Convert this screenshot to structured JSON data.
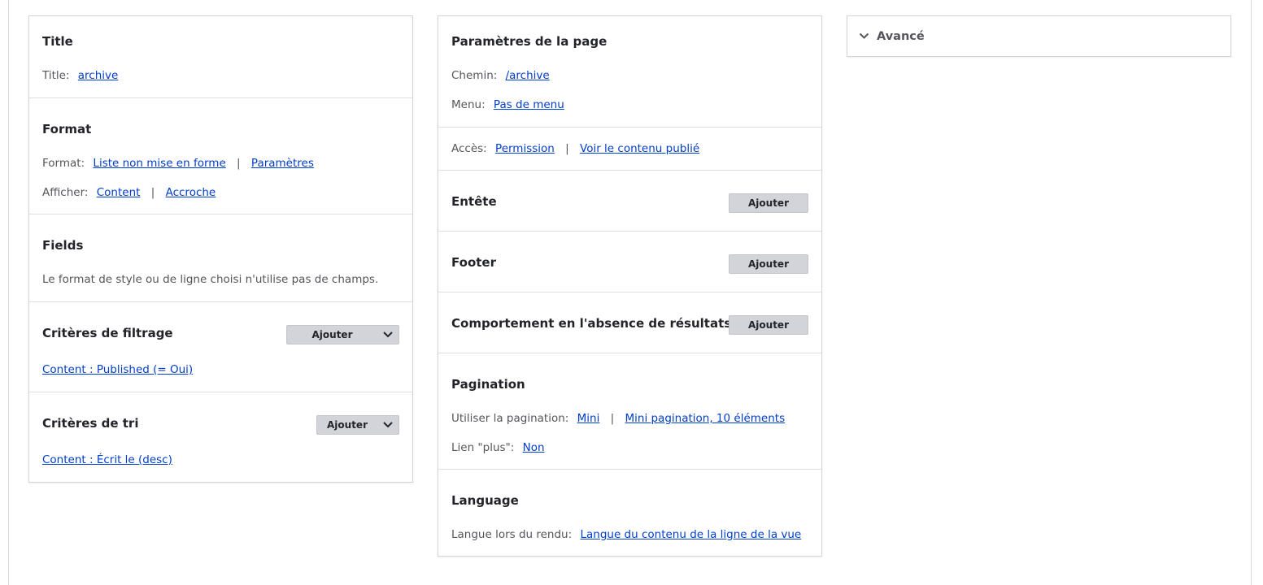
{
  "col1": {
    "title_section": {
      "heading": "Title",
      "label": "Title:",
      "value": "archive"
    },
    "format_section": {
      "heading": "Format",
      "format_label": "Format:",
      "format_value": "Liste non mise en forme",
      "format_settings": "Paramètres",
      "show_label": "Afficher:",
      "show_value": "Content",
      "show_settings": "Accroche"
    },
    "fields_section": {
      "heading": "Fields",
      "note": "Le format de style ou de ligne choisi n'utilise pas de champs."
    },
    "filter_section": {
      "heading": "Critères de filtrage",
      "add_label": "Ajouter",
      "item": "Content : Published (= Oui)"
    },
    "sort_section": {
      "heading": "Critères de tri",
      "add_label": "Ajouter",
      "item": "Content : Écrit le (desc)"
    }
  },
  "col2": {
    "page_section": {
      "heading": "Paramètres de la page",
      "path_label": "Chemin:",
      "path_value": "/archive",
      "menu_label": "Menu:",
      "menu_value": "Pas de menu"
    },
    "access_section": {
      "label": "Accès:",
      "value": "Permission",
      "extra": "Voir le contenu publié"
    },
    "header_section": {
      "heading": "Entête",
      "add_label": "Ajouter"
    },
    "footer_section": {
      "heading": "Footer",
      "add_label": "Ajouter"
    },
    "empty_section": {
      "heading": "Comportement en l'absence de résultats",
      "add_label": "Ajouter"
    },
    "pager_section": {
      "heading": "Pagination",
      "use_label": "Utiliser la pagination:",
      "use_value": "Mini",
      "use_detail": "Mini pagination, 10 éléments",
      "more_label": "Lien \"plus\":",
      "more_value": "Non"
    },
    "language_section": {
      "heading": "Language",
      "label": "Langue lors du rendu:",
      "value": "Langue du contenu de la ligne de la vue"
    }
  },
  "col3": {
    "advanced_label": "Avancé"
  },
  "icons": {
    "chevron": "chevron-down-icon"
  },
  "colors": {
    "link": "#003ecc",
    "button_bg": "#d3d4d9",
    "border": "#d4d4d9"
  }
}
